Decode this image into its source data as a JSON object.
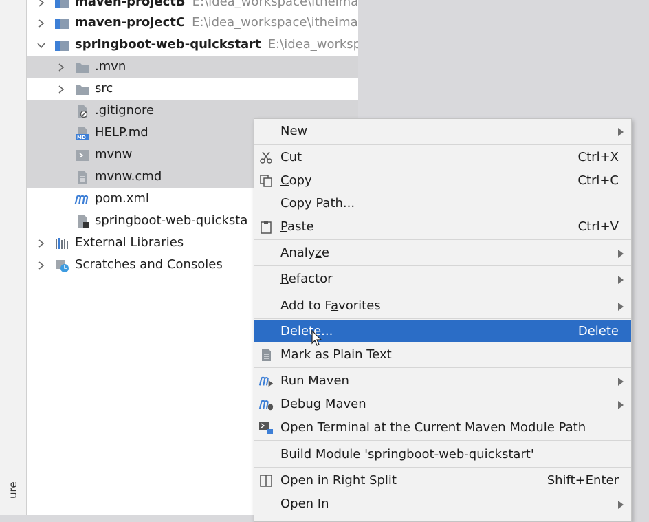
{
  "side_panel": {
    "vertical_label": "ure"
  },
  "tree": {
    "items": [
      {
        "name": "maven-projectB",
        "path": "E:\\idea_workspace\\itheima"
      },
      {
        "name": "maven-projectC",
        "path": "E:\\idea_workspace\\itheima"
      },
      {
        "name": "springboot-web-quickstart",
        "path": "E:\\idea_workspa"
      },
      {
        "name": ".mvn"
      },
      {
        "name": "src"
      },
      {
        "name": ".gitignore"
      },
      {
        "name": "HELP.md"
      },
      {
        "name": "mvnw"
      },
      {
        "name": "mvnw.cmd"
      },
      {
        "name": "pom.xml"
      },
      {
        "name": "springboot-web-quicksta"
      },
      {
        "name": "External Libraries"
      },
      {
        "name": "Scratches and Consoles"
      }
    ],
    "md_badge": "MD"
  },
  "context_menu": {
    "items": [
      {
        "pre": "New",
        "ul": "",
        "post": "",
        "shortcut": ""
      },
      {
        "pre": "Cu",
        "ul": "t",
        "post": "",
        "shortcut": "Ctrl+X"
      },
      {
        "pre": "",
        "ul": "C",
        "post": "opy",
        "shortcut": "Ctrl+C"
      },
      {
        "pre": "Copy Path...",
        "ul": "",
        "post": "",
        "shortcut": ""
      },
      {
        "pre": "",
        "ul": "P",
        "post": "aste",
        "shortcut": "Ctrl+V"
      },
      {
        "pre": "Analy",
        "ul": "z",
        "post": "e",
        "shortcut": ""
      },
      {
        "pre": "",
        "ul": "R",
        "post": "efactor",
        "shortcut": ""
      },
      {
        "pre": "Add to F",
        "ul": "a",
        "post": "vorites",
        "shortcut": ""
      },
      {
        "pre": "",
        "ul": "D",
        "post": "elete...",
        "shortcut": "Delete"
      },
      {
        "pre": "Mark as Plain Text",
        "ul": "",
        "post": "",
        "shortcut": ""
      },
      {
        "pre": "Run Maven",
        "ul": "",
        "post": "",
        "shortcut": ""
      },
      {
        "pre": "Debug Maven",
        "ul": "",
        "post": "",
        "shortcut": ""
      },
      {
        "pre": "Open Terminal at the Current Maven Module Path",
        "ul": "",
        "post": "",
        "shortcut": ""
      },
      {
        "pre": "Build ",
        "ul": "M",
        "post": "odule 'springboot-web-quickstart'",
        "shortcut": ""
      },
      {
        "pre": "Open in Right Split",
        "ul": "",
        "post": "",
        "shortcut": "Shift+Enter"
      },
      {
        "pre": "Open In",
        "ul": "",
        "post": "",
        "shortcut": ""
      }
    ]
  },
  "colors": {
    "highlight": "#2b6dc6",
    "selection": "#d5d5d7",
    "maven_blue": "#3d7fd6",
    "menu_background": "#f2f2f2"
  }
}
